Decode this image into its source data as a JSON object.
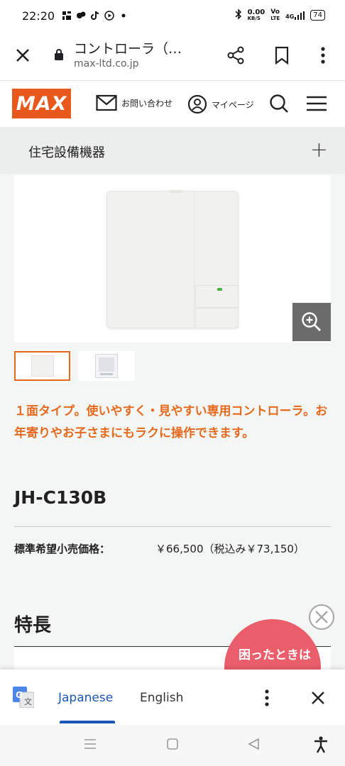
{
  "status": {
    "time": "22:20",
    "net_speed_top": "0.00",
    "net_speed_unit": "KB/S",
    "volte_top": "Vo",
    "volte_bottom": "LTE",
    "signal_label": "4G",
    "battery": "74"
  },
  "browser": {
    "title": "コントローラ（…",
    "url": "max-ltd.co.jp"
  },
  "site": {
    "logo_text": "MAX",
    "contact_label": "お問い合わせ",
    "mypage_label": "マイページ"
  },
  "category": {
    "label": "住宅設備機器",
    "expand_symbol": "+"
  },
  "product": {
    "description": "１面タイプ。使いやすく・見やすい専用コントローラ。お年寄りやお子さまにもラクに操作できます。",
    "model": "JH-C130B",
    "price_label": "標準希望小売価格：",
    "price_value": "￥66,500（税込み￥73,150）",
    "features_heading": "特長",
    "help_bubble": "困ったときは"
  },
  "translate": {
    "tab_source": "Japanese",
    "tab_target": "English"
  },
  "colors": {
    "brand": "#e8571c",
    "description_text": "#e5691c",
    "translate_active": "#1a56b5",
    "bubble": "#ea5e6b"
  }
}
